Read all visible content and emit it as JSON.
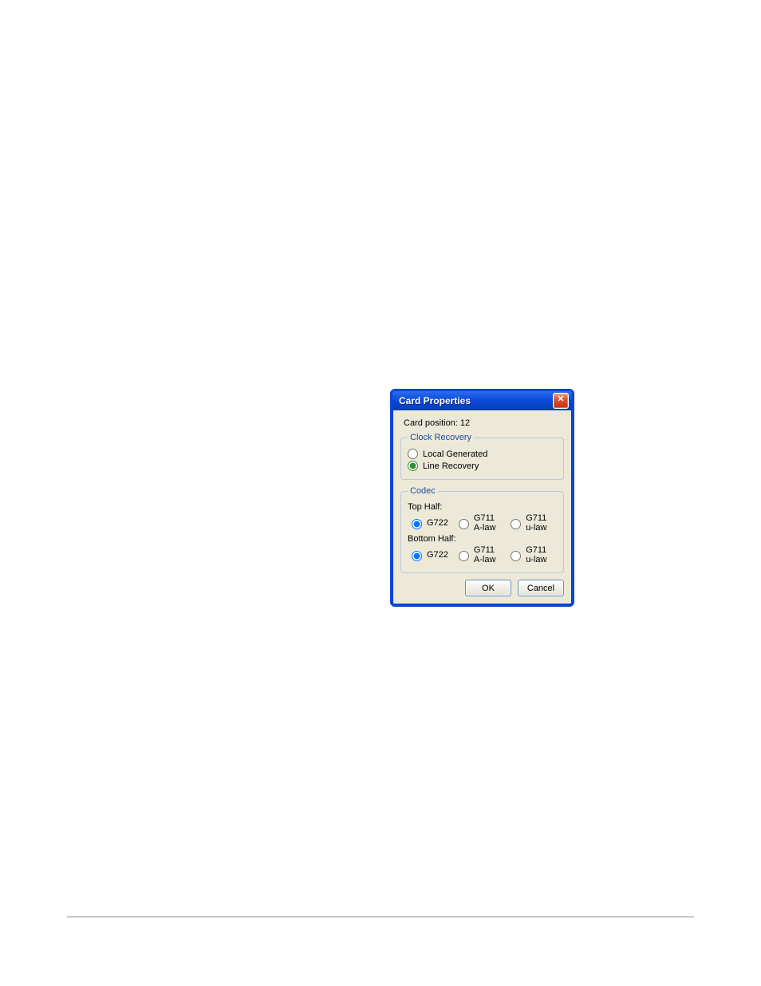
{
  "dialog": {
    "title": "Card Properties",
    "card_position_label": "Card position: 12",
    "clock_recovery": {
      "legend": "Clock Recovery",
      "options": {
        "local": "Local Generated",
        "line": "Line Recovery"
      },
      "selected": "line"
    },
    "codec": {
      "legend": "Codec",
      "top_label": "Top Half:",
      "bottom_label": "Bottom Half:",
      "options": {
        "g722": "G722",
        "g711a": "G711 A-law",
        "g711u": "G711 u-law"
      },
      "top_selected": "g722",
      "bottom_selected": "g722"
    },
    "buttons": {
      "ok": "OK",
      "cancel": "Cancel"
    }
  }
}
